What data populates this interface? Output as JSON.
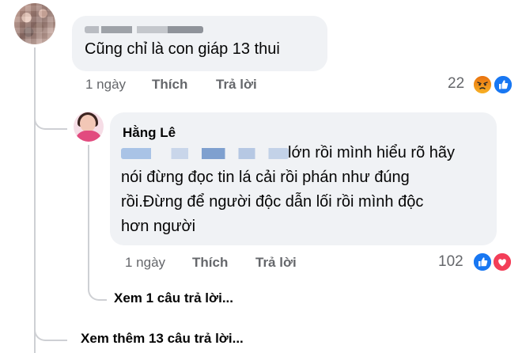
{
  "comment1": {
    "author": "",
    "text": "Cũng chỉ là con giáp 13 thui",
    "time": "1 ngày",
    "like_label": "Thích",
    "reply_label": "Trả lời",
    "reaction_count": "22",
    "reactions": [
      "angry-icon",
      "like-icon"
    ]
  },
  "comment2": {
    "author": "Hằng Lê",
    "text_line1": "lớn rồi mình hiểu rõ hãy",
    "text_line2": "nói đừng đọc tin lá cải rồi phán như đúng",
    "text_line3": "rồi.Đừng để người độc dẫn lối rồi mình độc",
    "text_line4": "hơn người",
    "time": "1 ngày",
    "like_label": "Thích",
    "reply_label": "Trả lời",
    "reaction_count": "102",
    "reactions": [
      "like-icon",
      "love-icon"
    ]
  },
  "view_replies": "Xem 1 câu trả lời...",
  "view_more": "Xem thêm 13 câu trả lời...",
  "colors": {
    "bubble": "#f0f2f5",
    "meta": "#65676b",
    "like_blue": "#1877f2",
    "love_red": "#f33e58",
    "angry_orange": "#e9710f"
  }
}
